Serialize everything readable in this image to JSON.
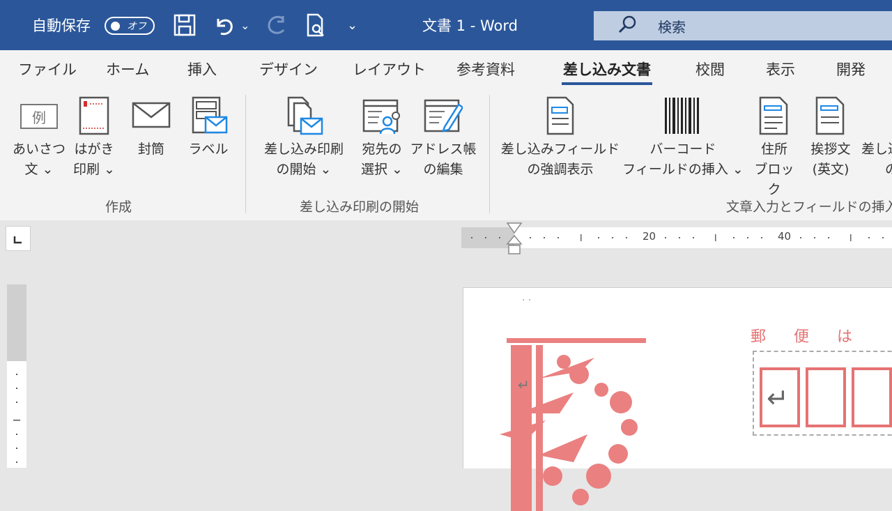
{
  "titlebar": {
    "autosave_label": "自動保存",
    "autosave_state": "オフ",
    "doc_title": "文書 1  -  Word",
    "search_placeholder": "検索",
    "bg_color": "#2b579a"
  },
  "tabs": [
    {
      "label": "ファイル"
    },
    {
      "label": "ホーム"
    },
    {
      "label": "挿入"
    },
    {
      "label": "デザイン"
    },
    {
      "label": "レイアウト"
    },
    {
      "label": "参考資料"
    },
    {
      "label": "差し込み文書",
      "active": true
    },
    {
      "label": "校閲"
    },
    {
      "label": "表示"
    },
    {
      "label": "開発"
    }
  ],
  "ribbon": {
    "groups": [
      {
        "label": "作成",
        "buttons": [
          {
            "line1": "あいさつ",
            "line2": "文 ⌄",
            "icon": "greeting-icon",
            "icon_text": "例"
          },
          {
            "line1": "はがき",
            "line2": "印刷 ⌄",
            "icon": "postcard-icon"
          },
          {
            "line1": "封筒",
            "line2": "",
            "icon": "envelope-icon"
          },
          {
            "line1": "ラベル",
            "line2": "",
            "icon": "label-icon"
          }
        ]
      },
      {
        "label": "差し込み印刷の開始",
        "buttons": [
          {
            "line1": "差し込み印刷",
            "line2": "の開始 ⌄",
            "icon": "start-merge-icon"
          },
          {
            "line1": "宛先の",
            "line2": "選択 ⌄",
            "icon": "select-recipients-icon"
          },
          {
            "line1": "アドレス帳",
            "line2": "の編集",
            "icon": "edit-address-book-icon"
          }
        ]
      },
      {
        "label": "文章入力とフィールドの挿入",
        "buttons": [
          {
            "line1": "差し込みフィールド",
            "line2": "の強調表示",
            "icon": "highlight-fields-icon"
          },
          {
            "line1": "バーコード",
            "line2": "フィールドの挿入 ⌄",
            "icon": "barcode-icon"
          },
          {
            "line1": "住所",
            "line2": "ブロック",
            "icon": "address-block-icon"
          },
          {
            "line1": "挨拶文",
            "line2": "(英文)",
            "icon": "greeting-line-icon"
          },
          {
            "line1": "差し込",
            "line2": "の",
            "icon": "insert-merge-field-icon"
          }
        ]
      }
    ]
  },
  "ruler": {
    "marks": [
      "20",
      "40"
    ]
  },
  "document": {
    "postal_header": "郵便は",
    "zip_boxes": 3,
    "accent_color": "#e57373"
  }
}
